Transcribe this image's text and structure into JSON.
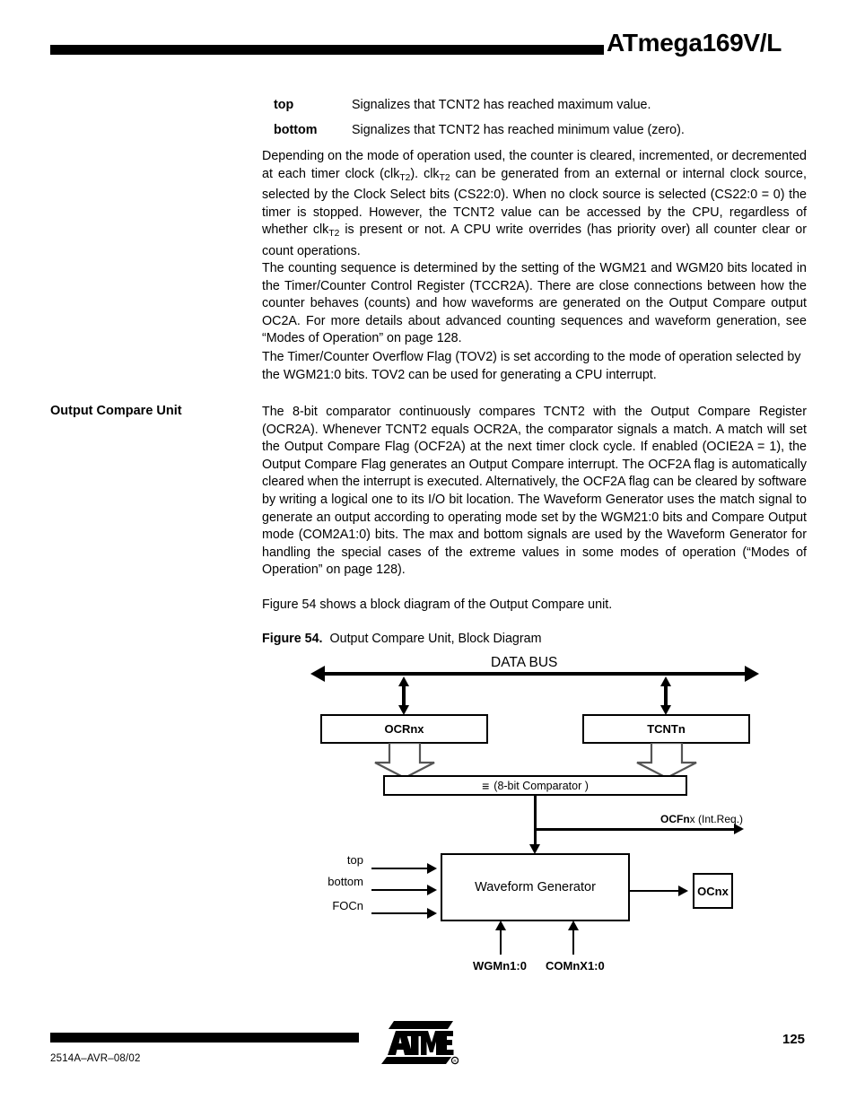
{
  "header": {
    "title": "ATmega169V/L"
  },
  "definitions": [
    {
      "term": "top",
      "description": "Signalizes that TCNT2 has reached maximum value."
    },
    {
      "term": "bottom",
      "description": "Signalizes that TCNT2 has reached minimum value (zero)."
    }
  ],
  "paragraphs": {
    "p1_a": "Depending on the mode of operation used, the counter is cleared, incremented, or decremented at each timer clock (clk",
    "p1_sub1": "T2",
    "p1_b": "). clk",
    "p1_sub2": "T2",
    "p1_c": " can be generated from an external or internal clock source, selected by the Clock Select bits (CS22:0). When no clock source is selected (CS22:0 = 0) the timer is stopped. However, the TCNT2 value can be accessed by the CPU, regardless of whether clk",
    "p1_sub3": "T2",
    "p1_d": " is present or not. A CPU write overrides (has priority over) all counter clear or count operations.",
    "p2": "The counting sequence is determined by the setting of the WGM21 and WGM20 bits located in the Timer/Counter Control Register (TCCR2A). There are close connections between how the counter behaves (counts) and how waveforms are generated on the Output Compare output OC2A. For more details about advanced counting sequences and waveform generation, see “Modes of Operation” on page 128.",
    "p3": "The Timer/Counter Overflow Flag (TOV2) is set according to the mode of operation selected by the WGM21:0 bits. TOV2 can be used for generating a CPU interrupt."
  },
  "section": {
    "heading": "Output Compare Unit",
    "body": "The 8-bit comparator continuously compares TCNT2 with the Output Compare Register (OCR2A). Whenever TCNT2 equals OCR2A, the comparator signals a match. A match will set the Output Compare Flag (OCF2A) at the next timer clock cycle. If enabled (OCIE2A = 1), the Output Compare Flag generates an Output Compare interrupt. The OCF2A flag is automatically cleared when the interrupt is executed. Alternatively, the OCF2A flag can be cleared by software by writing a logical one to its I/O bit location. The Waveform Generator uses the match signal to generate an output according to operating mode set by the WGM21:0 bits and Compare Output mode (COM2A1:0) bits. The max and bottom signals are used by the Waveform Generator for handling the special cases of the extreme values in some modes of operation (“Modes of Operation” on page 128).",
    "body2": "Figure 54 shows a block diagram of the Output Compare unit."
  },
  "figure": {
    "caption_label": "Figure 54.",
    "caption_text": "Output Compare Unit, Block Diagram",
    "data_bus_label": "DATA BUS",
    "ocr_box": "OCRnx",
    "tcnt_box": "TCNTn",
    "comparator_eq": "≡",
    "comparator_text": "(8-bit Comparator )",
    "ocf_bold": "OCFn",
    "ocf_x": "x",
    "ocf_rest": " (Int.Req.)",
    "waveform_box": "Waveform Generator",
    "oc_box": "OCnx",
    "inputs": [
      {
        "label": "top"
      },
      {
        "label": "bottom"
      },
      {
        "label": "FOCn"
      }
    ],
    "bottom_inputs": [
      {
        "label": "WGMn1:0"
      },
      {
        "label": "COMnX1:0"
      }
    ]
  },
  "footer": {
    "doc_id": "2514A–AVR–08/02",
    "page_number": "125",
    "logo_text": "ATMEL",
    "registered_mark": "®"
  }
}
